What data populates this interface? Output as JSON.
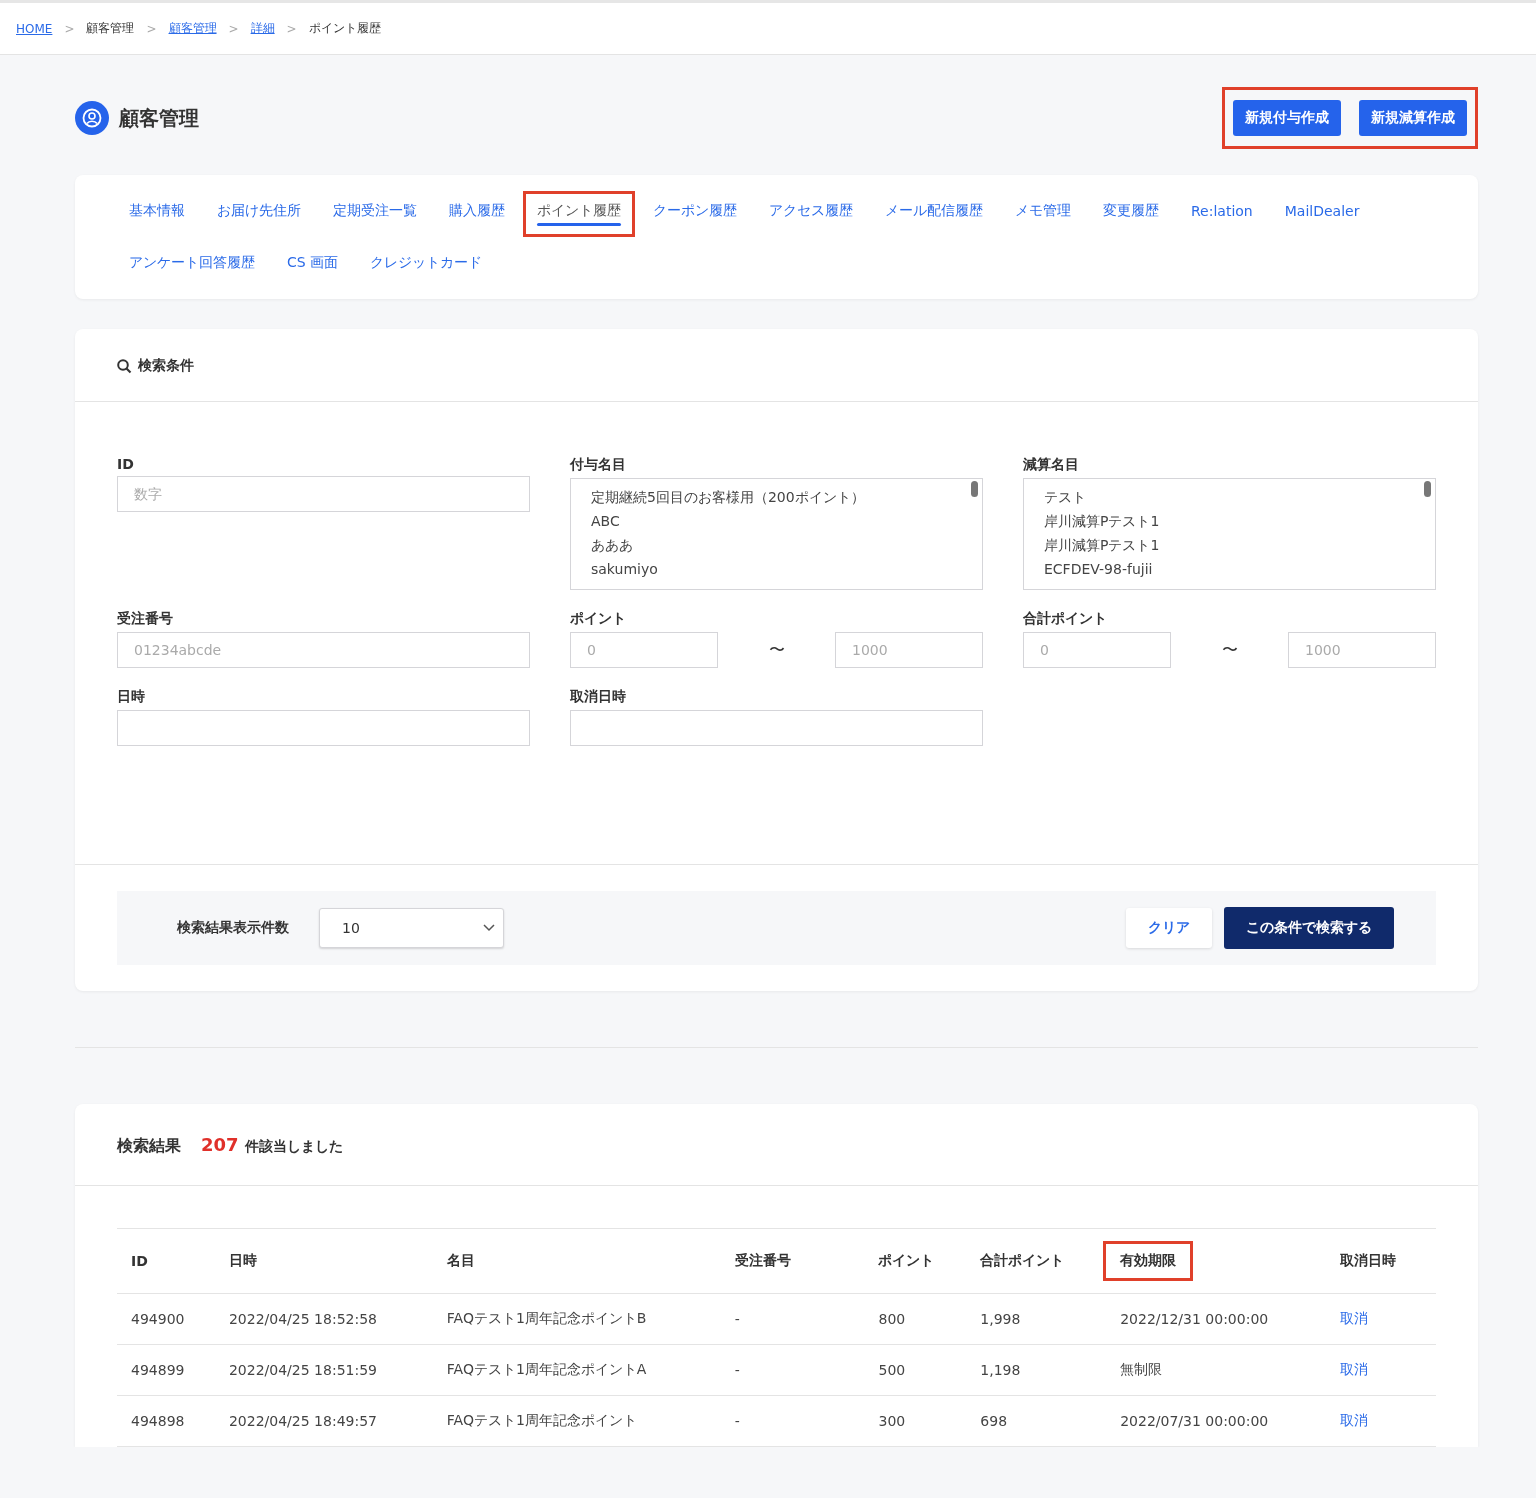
{
  "breadcrumb": [
    {
      "label": "HOME",
      "link": true
    },
    {
      "label": "顧客管理",
      "link": false
    },
    {
      "label": "顧客管理",
      "link": true
    },
    {
      "label": "詳細",
      "link": true
    },
    {
      "label": "ポイント履歴",
      "link": false
    }
  ],
  "breadcrumb_separator": ">",
  "page_title": "顧客管理",
  "header_buttons": {
    "highlighted": true,
    "items": [
      "新規付与作成",
      "新規減算作成"
    ]
  },
  "tabs": [
    {
      "label": "基本情報",
      "selected": false,
      "highlighted": false
    },
    {
      "label": "お届け先住所",
      "selected": false,
      "highlighted": false
    },
    {
      "label": "定期受注一覧",
      "selected": false,
      "highlighted": false
    },
    {
      "label": "購入履歴",
      "selected": false,
      "highlighted": false
    },
    {
      "label": "ポイント履歴",
      "selected": true,
      "highlighted": true
    },
    {
      "label": "クーポン履歴",
      "selected": false,
      "highlighted": false
    },
    {
      "label": "アクセス履歴",
      "selected": false,
      "highlighted": false
    },
    {
      "label": "メール配信履歴",
      "selected": false,
      "highlighted": false
    },
    {
      "label": "メモ管理",
      "selected": false,
      "highlighted": false
    },
    {
      "label": "変更履歴",
      "selected": false,
      "highlighted": false
    },
    {
      "label": "Re:lation",
      "selected": false,
      "highlighted": false
    },
    {
      "label": "MailDealer",
      "selected": false,
      "highlighted": false
    },
    {
      "label": "アンケート回答履歴",
      "selected": false,
      "highlighted": false
    },
    {
      "label": "CS 画面",
      "selected": false,
      "highlighted": false
    },
    {
      "label": "クレジットカード",
      "selected": false,
      "highlighted": false
    }
  ],
  "search": {
    "title": "検索条件",
    "id": {
      "label": "ID",
      "placeholder": "数字"
    },
    "grant_name": {
      "label": "付与名目",
      "options": [
        "定期継続5回目のお客様用（200ポイント）",
        "ABC",
        "あああ",
        "sakumiyo"
      ]
    },
    "deduct_name": {
      "label": "減算名目",
      "options": [
        "テスト",
        "岸川減算Pテスト1",
        "岸川減算Pテスト1",
        "ECFDEV-98-fujii"
      ]
    },
    "order_number": {
      "label": "受注番号",
      "placeholder": "01234abcde"
    },
    "points": {
      "label": "ポイント",
      "from_placeholder": "0",
      "to_placeholder": "1000",
      "separator": "〜"
    },
    "total_points": {
      "label": "合計ポイント",
      "from_placeholder": "0",
      "to_placeholder": "1000",
      "separator": "〜"
    },
    "datetime": {
      "label": "日時"
    },
    "cancel_datetime": {
      "label": "取消日時"
    },
    "page_size_label": "検索結果表示件数",
    "page_size": "10",
    "clear_button": "クリア",
    "search_button": "この条件で検索する"
  },
  "results": {
    "title": "検索結果",
    "count": "207",
    "count_suffix": "件該当しました",
    "columns": [
      {
        "label": "ID",
        "highlighted": false
      },
      {
        "label": "日時",
        "highlighted": false
      },
      {
        "label": "名目",
        "highlighted": false
      },
      {
        "label": "受注番号",
        "highlighted": false
      },
      {
        "label": "ポイント",
        "highlighted": false
      },
      {
        "label": "合計ポイント",
        "highlighted": false
      },
      {
        "label": "有効期限",
        "highlighted": true
      },
      {
        "label": "取消日時",
        "highlighted": false
      }
    ],
    "rows": [
      [
        "494900",
        "2022/04/25 18:52:58",
        "FAQテスト1周年記念ポイントB",
        "-",
        "800",
        "1,998",
        "2022/12/31 00:00:00",
        "取消"
      ],
      [
        "494899",
        "2022/04/25 18:51:59",
        "FAQテスト1周年記念ポイントA",
        "-",
        "500",
        "1,198",
        "無制限",
        "取消"
      ],
      [
        "494898",
        "2022/04/25 18:49:57",
        "FAQテスト1周年記念ポイント",
        "-",
        "300",
        "698",
        "2022/07/31 00:00:00",
        "取消"
      ]
    ]
  }
}
